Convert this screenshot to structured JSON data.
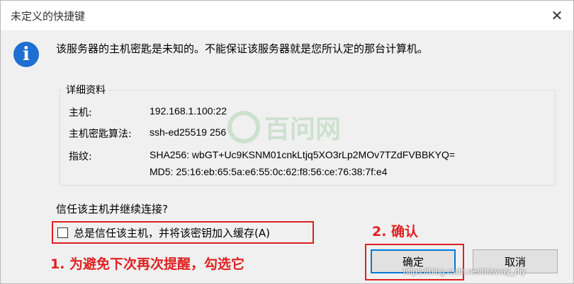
{
  "window": {
    "title": "未定义的快捷键",
    "close_glyph": "✕"
  },
  "message": {
    "text": "该服务器的主机密匙是未知的。不能保证该服务器就是您所认定的那台计算机。",
    "icon": "info-icon",
    "icon_glyph": "i"
  },
  "details": {
    "legend": "详细资料",
    "host_label": "主机:",
    "host_value": "192.168.1.100:22",
    "algo_label": "主机密匙算法:",
    "algo_value": "ssh-ed25519 256",
    "fingerprint_label": "指纹:",
    "fingerprint_sha256": "SHA256: wbGT+Uc9KSNM01cnkLtjq5XO3rLp2MOv7TZdFVBBKYQ=",
    "fingerprint_md5": "MD5: 25:16:eb:65:5a:e6:55:0c:62:f8:56:ce:76:38:7f:e4"
  },
  "watermark": {
    "text": "百问网"
  },
  "trust": {
    "question": "信任该主机并继续连接?",
    "checkbox_label": "总是信任该主机，并将该密钥加入缓存(A)",
    "checked": false
  },
  "annotations": {
    "step1": "1. 为避免下次再次提醒，勾选它",
    "step2": "2. 确认",
    "color": "#e02020"
  },
  "buttons": {
    "ok": "确定",
    "cancel": "取消"
  },
  "url_watermark": "https://blog.csdn.net/thisway_diy"
}
